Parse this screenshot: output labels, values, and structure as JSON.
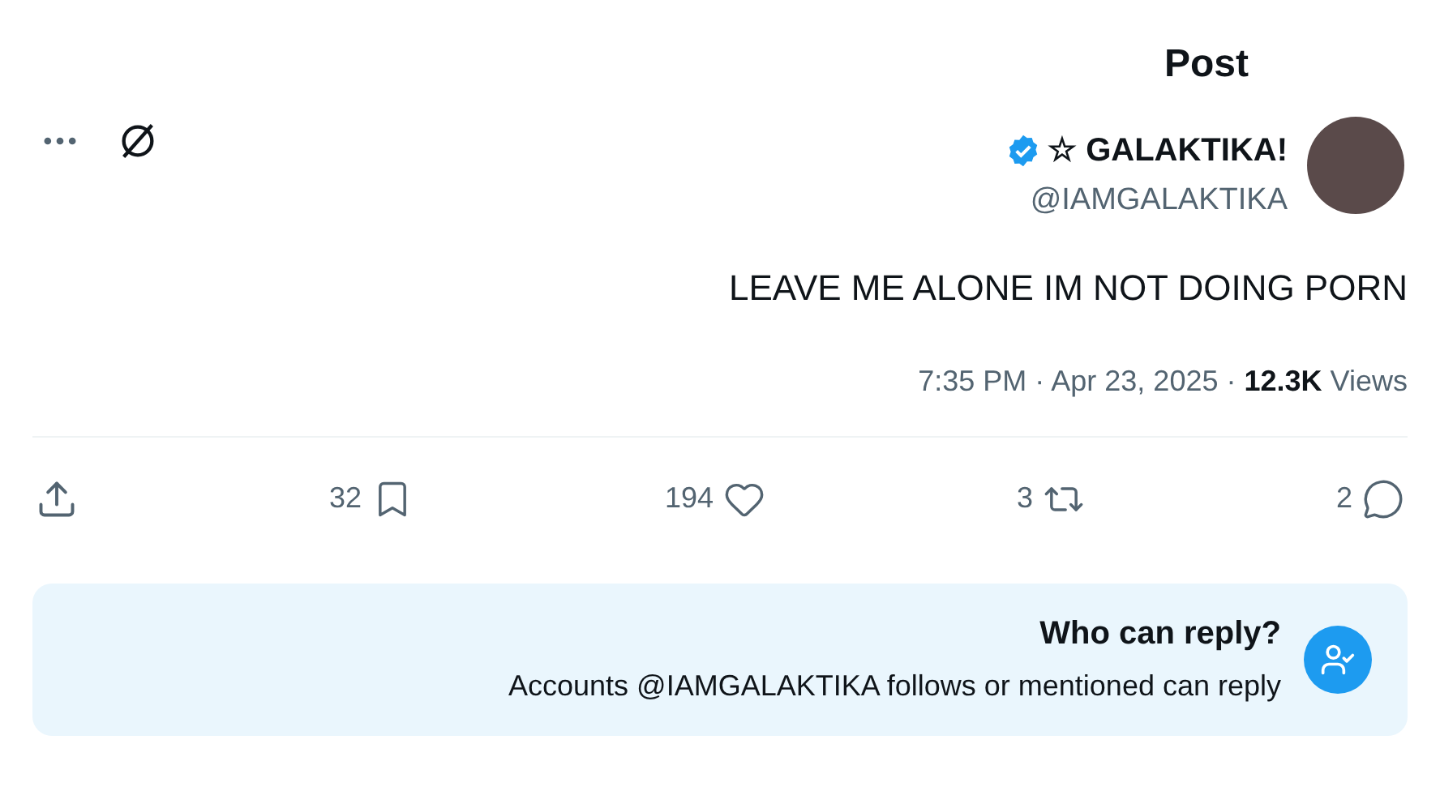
{
  "header": {
    "title": "Post"
  },
  "author": {
    "name": "☆ GALAKTIKA!",
    "verified": true,
    "handle": "@IAMGALAKTIKA"
  },
  "text": "LEAVE ME ALONE IM NOT DOING PORN",
  "meta": {
    "time": "7:35 PM · Apr 23, 2025 · ",
    "views_count": "12.3K",
    "views_label": "Views"
  },
  "actions": [
    {
      "kind": "share"
    },
    {
      "kind": "bookmark",
      "count": "32"
    },
    {
      "kind": "like",
      "count": "194"
    },
    {
      "kind": "repost",
      "count": "3"
    },
    {
      "kind": "reply",
      "count": "2"
    }
  ],
  "reply_notice": {
    "title": "Who can reply?",
    "text": "Accounts @IAMGALAKTIKA follows or mentioned can reply"
  }
}
